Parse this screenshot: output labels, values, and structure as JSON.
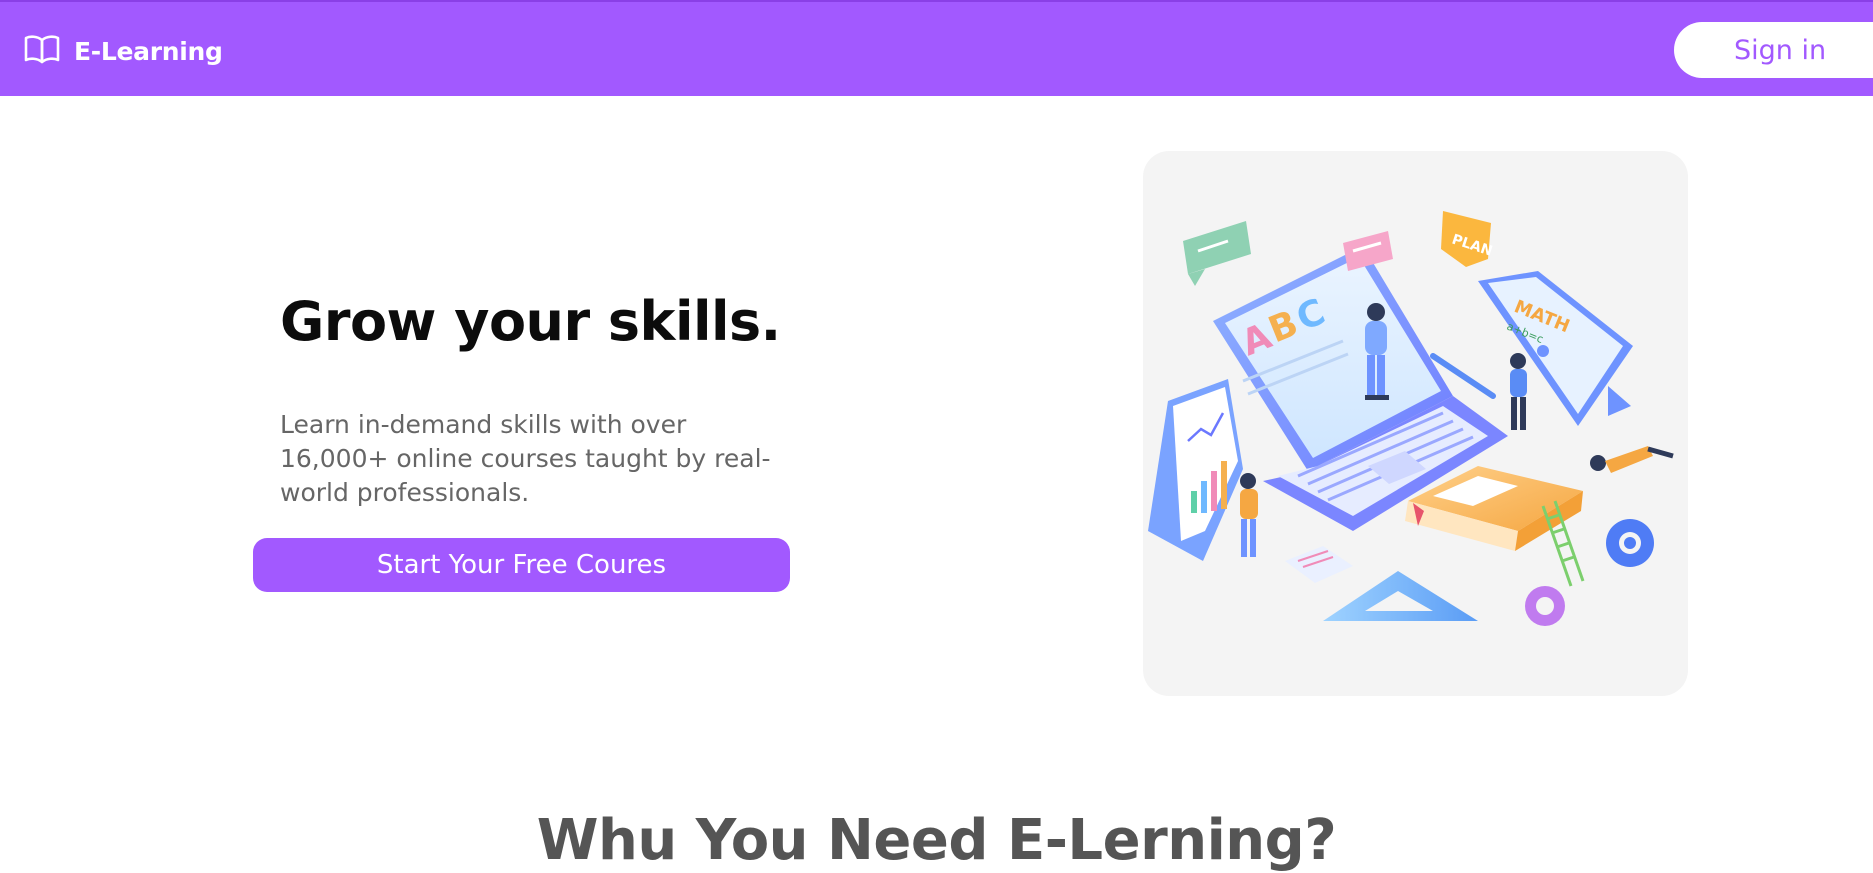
{
  "navbar": {
    "brand_name": "E-Learning",
    "brand_icon": "open-book-icon",
    "signin_label": "Sign in"
  },
  "hero": {
    "title": "Grow your skills.",
    "subtitle": "Learn in-demand skills with over 16,000+ online courses taught by real-world professionals.",
    "cta_label": "Start Your Free Coures",
    "illustration": {
      "laptop_text": "ABC",
      "tablet_title": "MATH",
      "tablet_formula": "a+b=c",
      "tag_label": "PLAN"
    }
  },
  "section": {
    "title": "Whu You Need E-Lerning?"
  },
  "colors": {
    "primary": "#a259ff",
    "white": "#ffffff",
    "text_dark": "#0c0c0c",
    "text_muted": "#666666",
    "illustration_bg": "#f4f4f4"
  }
}
